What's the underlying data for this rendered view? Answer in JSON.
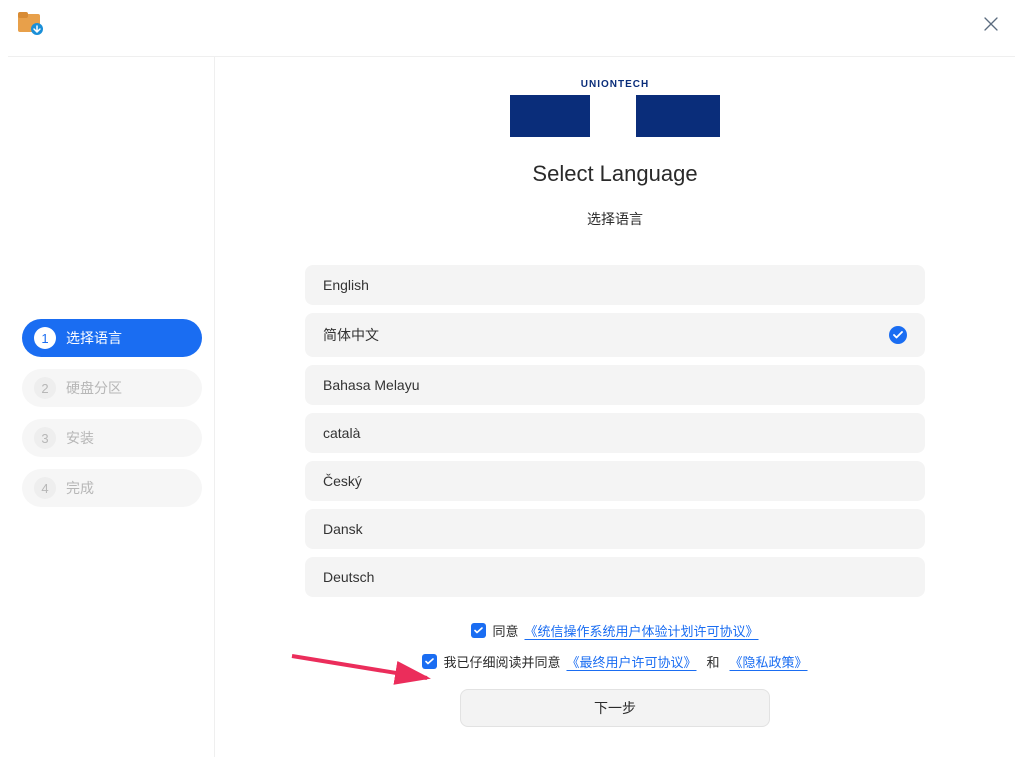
{
  "logo": {
    "label": "UNIONTECH"
  },
  "header": {
    "title_en": "Select Language",
    "title_zh": "选择语言"
  },
  "sidebar": {
    "steps": [
      {
        "num": "1",
        "label": "选择语言",
        "active": true
      },
      {
        "num": "2",
        "label": "硬盘分区",
        "active": false
      },
      {
        "num": "3",
        "label": "安装",
        "active": false
      },
      {
        "num": "4",
        "label": "完成",
        "active": false
      }
    ]
  },
  "languages": [
    {
      "name": "English",
      "selected": false
    },
    {
      "name": "简体中文",
      "selected": true
    },
    {
      "name": "Bahasa Melayu",
      "selected": false
    },
    {
      "name": "català",
      "selected": false
    },
    {
      "name": "Český",
      "selected": false
    },
    {
      "name": "Dansk",
      "selected": false
    },
    {
      "name": "Deutsch",
      "selected": false
    }
  ],
  "agreements": {
    "row1": {
      "checked": true,
      "text": "同意",
      "link1": "《统信操作系统用户体验计划许可协议》"
    },
    "row2": {
      "checked": true,
      "text": "我已仔细阅读并同意",
      "link1": "《最终用户许可协议》",
      "and": "和",
      "link2": "《隐私政策》"
    }
  },
  "buttons": {
    "next": "下一步"
  }
}
